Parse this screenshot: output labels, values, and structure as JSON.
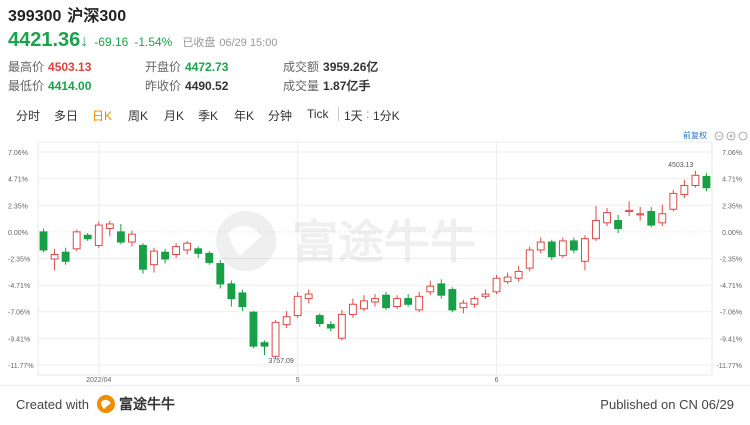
{
  "header": {
    "code": "399300",
    "name": "沪深300",
    "price": "4421.36",
    "change": "-69.16",
    "change_pct": "-1.54%",
    "status": "已收盘",
    "datetime": "06/29 15:00"
  },
  "stats": {
    "high_label": "最高价",
    "high": "4503.13",
    "low_label": "最低价",
    "low": "4414.00",
    "open_label": "开盘价",
    "open": "4472.73",
    "prev_label": "昨收价",
    "prev": "4490.52",
    "amount_label": "成交额",
    "amount": "3959.26亿",
    "volume_label": "成交量",
    "volume": "1.87亿手"
  },
  "tabs": [
    "分时",
    "多日",
    "日K",
    "周K",
    "月K",
    "季K",
    "年K",
    "分钟",
    "Tick"
  ],
  "active_tab": "日K",
  "period_select": "1天",
  "interval_select": "1分K",
  "chart_tools": {
    "adjust_label": "前复权"
  },
  "chart_data": {
    "type": "candlestick",
    "y_ticks_left": [
      "7.06%",
      "4.71%",
      "2.35%",
      "0.00%",
      "-2.35%",
      "-4.71%",
      "-7.06%",
      "-9.41%",
      "-11.77%"
    ],
    "y_ticks_right": [
      "7.06%",
      "4.71%",
      "2.35%",
      "0.00%",
      "-2.35%",
      "-4.71%",
      "-7.06%",
      "-9.41%",
      "-11.77%"
    ],
    "ylim": [
      -11.77,
      7.06
    ],
    "x_labels": [
      {
        "text": "2022/04",
        "index": 5
      },
      {
        "text": "5",
        "index": 23
      },
      {
        "text": "6",
        "index": 41
      }
    ],
    "annotations": [
      {
        "text": "4503.13",
        "index": 59,
        "value": 5.2
      },
      {
        "text": "3757.09",
        "index": 20,
        "value": -10.9
      }
    ],
    "candles": [
      {
        "o": 0.0,
        "c": -1.6,
        "h": 0.3,
        "l": -1.8
      },
      {
        "o": -2.4,
        "c": -2.0,
        "h": -1.5,
        "l": -3.4
      },
      {
        "o": -1.8,
        "c": -2.6,
        "h": -1.4,
        "l": -2.9
      },
      {
        "o": -1.5,
        "c": 0.0,
        "h": 0.2,
        "l": -1.7
      },
      {
        "o": -0.3,
        "c": -0.6,
        "h": -0.1,
        "l": -0.8
      },
      {
        "o": -1.2,
        "c": 0.6,
        "h": 0.9,
        "l": -1.4
      },
      {
        "o": 0.3,
        "c": 0.7,
        "h": 1.0,
        "l": -0.4
      },
      {
        "o": 0.0,
        "c": -0.9,
        "h": 0.7,
        "l": -1.1
      },
      {
        "o": -0.9,
        "c": -0.2,
        "h": 0.1,
        "l": -1.3
      },
      {
        "o": -1.2,
        "c": -3.3,
        "h": -1.0,
        "l": -3.7
      },
      {
        "o": -2.9,
        "c": -1.7,
        "h": -1.4,
        "l": -3.6
      },
      {
        "o": -1.8,
        "c": -2.4,
        "h": -1.5,
        "l": -2.8
      },
      {
        "o": -2.0,
        "c": -1.3,
        "h": -1.0,
        "l": -2.3
      },
      {
        "o": -1.6,
        "c": -1.0,
        "h": -0.8,
        "l": -2.0
      },
      {
        "o": -1.5,
        "c": -1.9,
        "h": -1.3,
        "l": -2.3
      },
      {
        "o": -1.9,
        "c": -2.7,
        "h": -1.7,
        "l": -2.9
      },
      {
        "o": -2.8,
        "c": -4.6,
        "h": -2.5,
        "l": -5.0
      },
      {
        "o": -4.6,
        "c": -5.9,
        "h": -4.3,
        "l": -6.6
      },
      {
        "o": -5.4,
        "c": -6.6,
        "h": -5.1,
        "l": -7.0
      },
      {
        "o": -7.1,
        "c": -10.1,
        "h": -7.0,
        "l": -10.3
      },
      {
        "o": -9.8,
        "c": -10.1,
        "h": -9.6,
        "l": -10.9
      },
      {
        "o": -11.0,
        "c": -8.0,
        "h": -7.8,
        "l": -11.2
      },
      {
        "o": -8.2,
        "c": -7.5,
        "h": -7.0,
        "l": -8.5
      },
      {
        "o": -7.4,
        "c": -5.7,
        "h": -5.3,
        "l": -7.6
      },
      {
        "o": -5.9,
        "c": -5.5,
        "h": -5.1,
        "l": -6.3
      },
      {
        "o": -7.4,
        "c": -8.1,
        "h": -7.2,
        "l": -8.4
      },
      {
        "o": -8.2,
        "c": -8.5,
        "h": -7.9,
        "l": -8.8
      },
      {
        "o": -9.4,
        "c": -7.3,
        "h": -6.9,
        "l": -9.6
      },
      {
        "o": -7.3,
        "c": -6.4,
        "h": -5.9,
        "l": -7.6
      },
      {
        "o": -6.8,
        "c": -6.1,
        "h": -5.6,
        "l": -7.0
      },
      {
        "o": -6.2,
        "c": -5.9,
        "h": -5.5,
        "l": -6.6
      },
      {
        "o": -5.6,
        "c": -6.7,
        "h": -5.3,
        "l": -6.9
      },
      {
        "o": -6.6,
        "c": -5.9,
        "h": -5.6,
        "l": -6.8
      },
      {
        "o": -5.9,
        "c": -6.4,
        "h": -5.5,
        "l": -6.6
      },
      {
        "o": -6.9,
        "c": -5.7,
        "h": -5.3,
        "l": -7.1
      },
      {
        "o": -5.3,
        "c": -4.8,
        "h": -4.3,
        "l": -5.6
      },
      {
        "o": -4.6,
        "c": -5.6,
        "h": -4.2,
        "l": -5.9
      },
      {
        "o": -5.1,
        "c": -6.9,
        "h": -4.9,
        "l": -7.1
      },
      {
        "o": -6.7,
        "c": -6.3,
        "h": -6.0,
        "l": -7.2
      },
      {
        "o": -6.4,
        "c": -5.9,
        "h": -5.7,
        "l": -6.7
      },
      {
        "o": -5.7,
        "c": -5.5,
        "h": -5.1,
        "l": -5.9
      },
      {
        "o": -5.3,
        "c": -4.1,
        "h": -3.8,
        "l": -5.5
      },
      {
        "o": -4.4,
        "c": -4.0,
        "h": -3.6,
        "l": -4.6
      },
      {
        "o": -4.1,
        "c": -3.5,
        "h": -3.0,
        "l": -4.4
      },
      {
        "o": -3.2,
        "c": -1.6,
        "h": -1.3,
        "l": -3.5
      },
      {
        "o": -1.6,
        "c": -0.9,
        "h": -0.5,
        "l": -1.9
      },
      {
        "o": -0.9,
        "c": -2.2,
        "h": -0.7,
        "l": -2.5
      },
      {
        "o": -2.1,
        "c": -0.8,
        "h": -0.5,
        "l": -2.3
      },
      {
        "o": -0.8,
        "c": -1.6,
        "h": -0.5,
        "l": -1.9
      },
      {
        "o": -2.6,
        "c": -0.6,
        "h": -0.3,
        "l": -3.4
      },
      {
        "o": -0.6,
        "c": 1.0,
        "h": 2.3,
        "l": -0.8
      },
      {
        "o": 0.8,
        "c": 1.7,
        "h": 2.1,
        "l": 0.5
      },
      {
        "o": 1.0,
        "c": 0.3,
        "h": 1.5,
        "l": -0.1
      },
      {
        "o": 1.8,
        "c": 1.9,
        "h": 2.7,
        "l": 1.4
      },
      {
        "o": 1.5,
        "c": 1.6,
        "h": 2.2,
        "l": 1.0
      },
      {
        "o": 1.8,
        "c": 0.6,
        "h": 2.2,
        "l": 0.4
      },
      {
        "o": 0.8,
        "c": 1.6,
        "h": 2.4,
        "l": 0.5
      },
      {
        "o": 2.0,
        "c": 3.4,
        "h": 3.7,
        "l": 1.8
      },
      {
        "o": 3.3,
        "c": 4.1,
        "h": 4.6,
        "l": 3.0
      },
      {
        "o": 4.1,
        "c": 5.0,
        "h": 5.4,
        "l": 3.9
      },
      {
        "o": 4.9,
        "c": 3.9,
        "h": 5.2,
        "l": 3.6
      }
    ]
  }
}
